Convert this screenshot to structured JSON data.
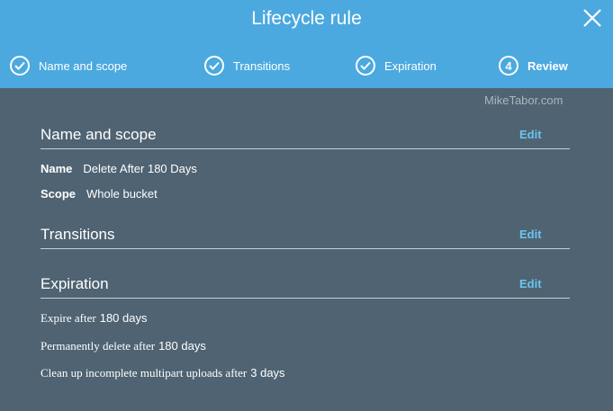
{
  "dialog": {
    "title": "Lifecycle rule",
    "watermark": "MikeTabor.com"
  },
  "steps": [
    {
      "label": "Name and scope",
      "state": "complete",
      "icon": "check-circle-icon"
    },
    {
      "label": "Transitions",
      "state": "complete",
      "icon": "check-circle-icon"
    },
    {
      "label": "Expiration",
      "state": "complete",
      "icon": "check-circle-icon"
    },
    {
      "label": "Review",
      "state": "active",
      "number": "4"
    }
  ],
  "sections": {
    "name_scope": {
      "title": "Name and scope",
      "edit": "Edit",
      "name_key": "Name",
      "name_value": "Delete After 180 Days",
      "scope_key": "Scope",
      "scope_value": "Whole bucket"
    },
    "transitions": {
      "title": "Transitions",
      "edit": "Edit"
    },
    "expiration": {
      "title": "Expiration",
      "edit": "Edit",
      "lines": [
        {
          "label": "Expire after",
          "value": "180 days"
        },
        {
          "label": "Permanently delete after",
          "value": "180 days"
        },
        {
          "label": "Clean up incomplete multipart uploads after",
          "value": "3 days"
        }
      ]
    }
  },
  "colors": {
    "header": "#4ba9df",
    "body": "#4f6372",
    "link": "#6cc3ee"
  }
}
